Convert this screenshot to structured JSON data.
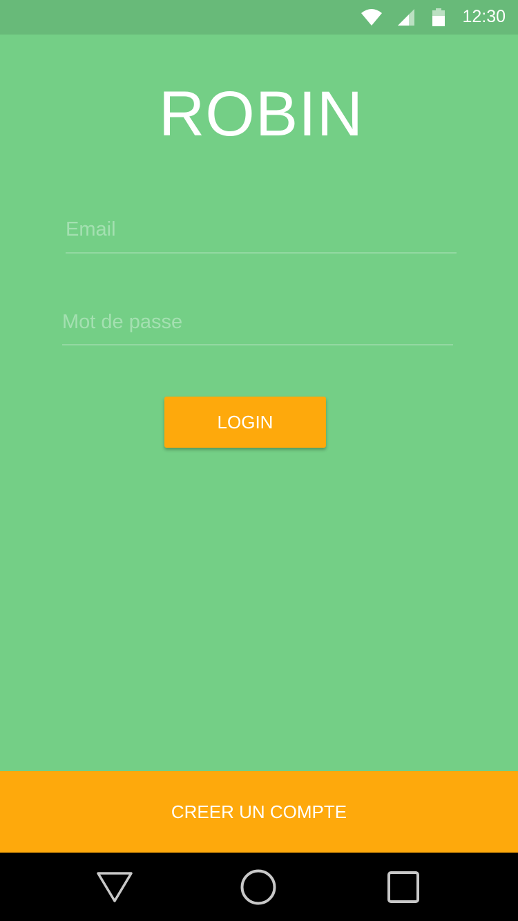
{
  "status_bar": {
    "time": "12:30",
    "icons": [
      "wifi-icon",
      "cell-signal-icon",
      "battery-icon"
    ]
  },
  "app": {
    "title": "ROBIN"
  },
  "login_form": {
    "email_placeholder": "Email",
    "email_value": "",
    "password_placeholder": "Mot de passe",
    "password_value": "",
    "login_label": "LOGIN"
  },
  "footer": {
    "create_account_label": "CREER UN COMPTE"
  },
  "nav_bar": {
    "icons": [
      "back-icon",
      "home-icon",
      "recent-apps-icon"
    ]
  },
  "colors": {
    "background": "#74CF86",
    "status_bar": "#68BA79",
    "accent": "#FEA90C",
    "nav_bar": "#000000",
    "text": "#FFFFFF"
  }
}
